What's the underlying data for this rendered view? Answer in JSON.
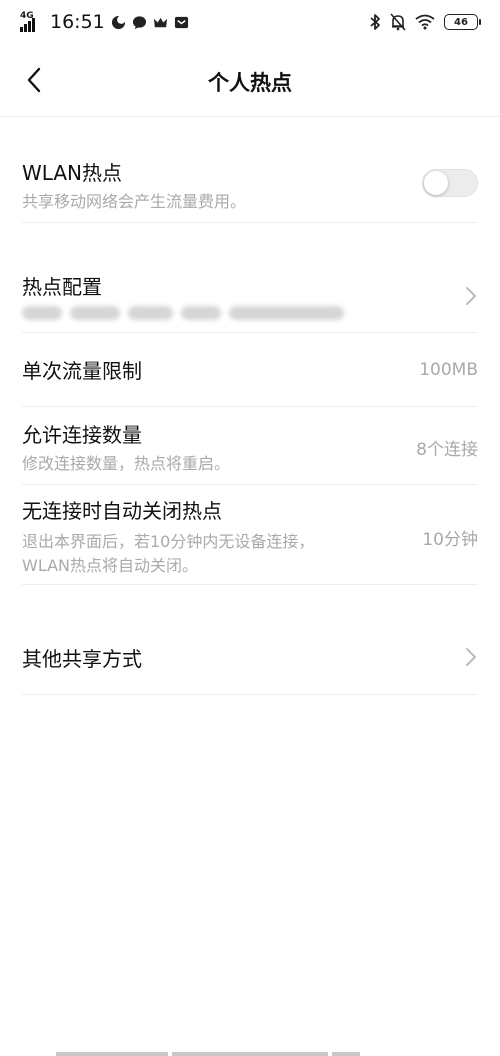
{
  "status_bar": {
    "network": "4G",
    "time": "16:51",
    "battery": "46"
  },
  "header": {
    "title": "个人热点"
  },
  "rows": {
    "wlan": {
      "title": "WLAN热点",
      "subtitle": "共享移动网络会产生流量费用。",
      "enabled": false
    },
    "config": {
      "title": "热点配置"
    },
    "data_limit": {
      "title": "单次流量限制",
      "value": "100MB"
    },
    "connections": {
      "title": "允许连接数量",
      "subtitle": "修改连接数量，热点将重启。",
      "value": "8个连接"
    },
    "auto_off": {
      "title": "无连接时自动关闭热点",
      "subtitle_line1": "退出本界面后，若10分钟内无设备连接，",
      "subtitle_line2": "WLAN热点将自动关闭。",
      "value": "10分钟"
    },
    "other": {
      "title": "其他共享方式"
    }
  },
  "colors": {
    "text": "#111111",
    "secondary": "#aaaaaa",
    "divider": "#eeeeee",
    "toggle_off": "#ececec"
  },
  "icons": [
    "signal-icon",
    "moon-icon",
    "chat-icon",
    "crown-icon",
    "mail-icon",
    "bluetooth-icon",
    "bell-off-icon",
    "wifi-icon",
    "battery-icon",
    "back-arrow-icon",
    "chevron-right-icon"
  ]
}
